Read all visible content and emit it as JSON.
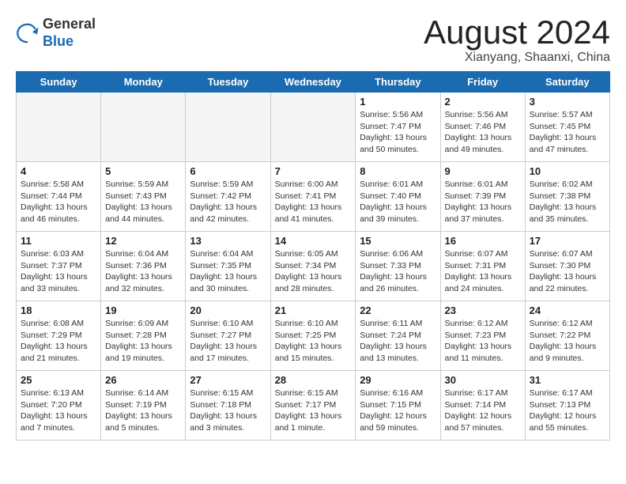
{
  "logo": {
    "line1": "General",
    "line2": "Blue"
  },
  "title": "August 2024",
  "subtitle": "Xianyang, Shaanxi, China",
  "days_of_week": [
    "Sunday",
    "Monday",
    "Tuesday",
    "Wednesday",
    "Thursday",
    "Friday",
    "Saturday"
  ],
  "weeks": [
    [
      {
        "day": "",
        "info": ""
      },
      {
        "day": "",
        "info": ""
      },
      {
        "day": "",
        "info": ""
      },
      {
        "day": "",
        "info": ""
      },
      {
        "day": "1",
        "info": "Sunrise: 5:56 AM\nSunset: 7:47 PM\nDaylight: 13 hours\nand 50 minutes."
      },
      {
        "day": "2",
        "info": "Sunrise: 5:56 AM\nSunset: 7:46 PM\nDaylight: 13 hours\nand 49 minutes."
      },
      {
        "day": "3",
        "info": "Sunrise: 5:57 AM\nSunset: 7:45 PM\nDaylight: 13 hours\nand 47 minutes."
      }
    ],
    [
      {
        "day": "4",
        "info": "Sunrise: 5:58 AM\nSunset: 7:44 PM\nDaylight: 13 hours\nand 46 minutes."
      },
      {
        "day": "5",
        "info": "Sunrise: 5:59 AM\nSunset: 7:43 PM\nDaylight: 13 hours\nand 44 minutes."
      },
      {
        "day": "6",
        "info": "Sunrise: 5:59 AM\nSunset: 7:42 PM\nDaylight: 13 hours\nand 42 minutes."
      },
      {
        "day": "7",
        "info": "Sunrise: 6:00 AM\nSunset: 7:41 PM\nDaylight: 13 hours\nand 41 minutes."
      },
      {
        "day": "8",
        "info": "Sunrise: 6:01 AM\nSunset: 7:40 PM\nDaylight: 13 hours\nand 39 minutes."
      },
      {
        "day": "9",
        "info": "Sunrise: 6:01 AM\nSunset: 7:39 PM\nDaylight: 13 hours\nand 37 minutes."
      },
      {
        "day": "10",
        "info": "Sunrise: 6:02 AM\nSunset: 7:38 PM\nDaylight: 13 hours\nand 35 minutes."
      }
    ],
    [
      {
        "day": "11",
        "info": "Sunrise: 6:03 AM\nSunset: 7:37 PM\nDaylight: 13 hours\nand 33 minutes."
      },
      {
        "day": "12",
        "info": "Sunrise: 6:04 AM\nSunset: 7:36 PM\nDaylight: 13 hours\nand 32 minutes."
      },
      {
        "day": "13",
        "info": "Sunrise: 6:04 AM\nSunset: 7:35 PM\nDaylight: 13 hours\nand 30 minutes."
      },
      {
        "day": "14",
        "info": "Sunrise: 6:05 AM\nSunset: 7:34 PM\nDaylight: 13 hours\nand 28 minutes."
      },
      {
        "day": "15",
        "info": "Sunrise: 6:06 AM\nSunset: 7:33 PM\nDaylight: 13 hours\nand 26 minutes."
      },
      {
        "day": "16",
        "info": "Sunrise: 6:07 AM\nSunset: 7:31 PM\nDaylight: 13 hours\nand 24 minutes."
      },
      {
        "day": "17",
        "info": "Sunrise: 6:07 AM\nSunset: 7:30 PM\nDaylight: 13 hours\nand 22 minutes."
      }
    ],
    [
      {
        "day": "18",
        "info": "Sunrise: 6:08 AM\nSunset: 7:29 PM\nDaylight: 13 hours\nand 21 minutes."
      },
      {
        "day": "19",
        "info": "Sunrise: 6:09 AM\nSunset: 7:28 PM\nDaylight: 13 hours\nand 19 minutes."
      },
      {
        "day": "20",
        "info": "Sunrise: 6:10 AM\nSunset: 7:27 PM\nDaylight: 13 hours\nand 17 minutes."
      },
      {
        "day": "21",
        "info": "Sunrise: 6:10 AM\nSunset: 7:25 PM\nDaylight: 13 hours\nand 15 minutes."
      },
      {
        "day": "22",
        "info": "Sunrise: 6:11 AM\nSunset: 7:24 PM\nDaylight: 13 hours\nand 13 minutes."
      },
      {
        "day": "23",
        "info": "Sunrise: 6:12 AM\nSunset: 7:23 PM\nDaylight: 13 hours\nand 11 minutes."
      },
      {
        "day": "24",
        "info": "Sunrise: 6:12 AM\nSunset: 7:22 PM\nDaylight: 13 hours\nand 9 minutes."
      }
    ],
    [
      {
        "day": "25",
        "info": "Sunrise: 6:13 AM\nSunset: 7:20 PM\nDaylight: 13 hours\nand 7 minutes."
      },
      {
        "day": "26",
        "info": "Sunrise: 6:14 AM\nSunset: 7:19 PM\nDaylight: 13 hours\nand 5 minutes."
      },
      {
        "day": "27",
        "info": "Sunrise: 6:15 AM\nSunset: 7:18 PM\nDaylight: 13 hours\nand 3 minutes."
      },
      {
        "day": "28",
        "info": "Sunrise: 6:15 AM\nSunset: 7:17 PM\nDaylight: 13 hours\nand 1 minute."
      },
      {
        "day": "29",
        "info": "Sunrise: 6:16 AM\nSunset: 7:15 PM\nDaylight: 12 hours\nand 59 minutes."
      },
      {
        "day": "30",
        "info": "Sunrise: 6:17 AM\nSunset: 7:14 PM\nDaylight: 12 hours\nand 57 minutes."
      },
      {
        "day": "31",
        "info": "Sunrise: 6:17 AM\nSunset: 7:13 PM\nDaylight: 12 hours\nand 55 minutes."
      }
    ]
  ]
}
